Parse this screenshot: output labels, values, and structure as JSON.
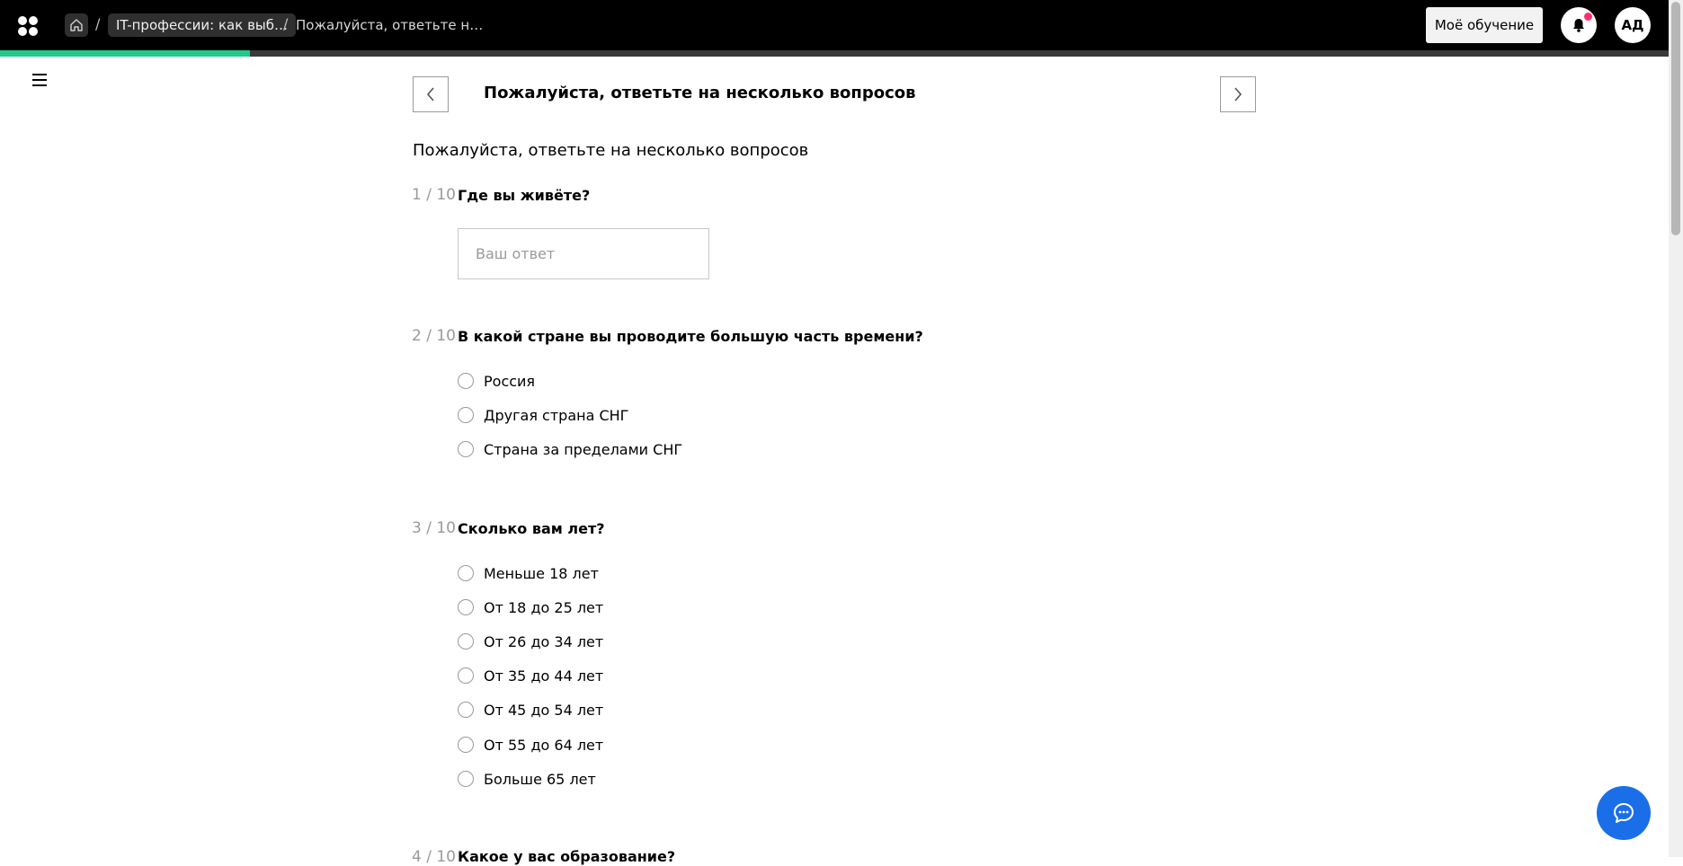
{
  "header": {
    "breadcrumb_course": "IT-профессии: как выб…",
    "breadcrumb_current": "Пожалуйста, ответьте н…",
    "breadcrumb_separator": "/",
    "my_learning_label": "Моё обучение",
    "avatar_initials": "АД",
    "course_progress_percent": 15,
    "colors": {
      "progress": "#23c98a",
      "notification_dot": "#ff2e6d"
    }
  },
  "main": {
    "title": "Пожалуйста, ответьте на несколько вопросов",
    "subtitle": "Пожалуйста, ответьте на несколько вопросов",
    "questions": [
      {
        "number": "1 / 10",
        "text": "Где вы живёте?",
        "input_placeholder": "Ваш ответ",
        "input_value": ""
      },
      {
        "number": "2 / 10",
        "text": "В какой стране вы проводите большую часть времени?",
        "options": [
          "Россия",
          "Другая страна СНГ",
          "Страна за пределами СНГ"
        ]
      },
      {
        "number": "3 / 10",
        "text": "Сколько вам лет?",
        "options": [
          "Меньше 18 лет",
          "От 18 до 25 лет",
          "От 26 до 34 лет",
          "От 35 до 44 лет",
          "От 45 до 54 лет",
          "От 55 до 64 лет",
          "Больше 65 лет"
        ]
      },
      {
        "number": "4 / 10",
        "text": "Какое у вас образование?"
      }
    ]
  },
  "icons": [
    "logo-icon",
    "home-icon",
    "bell-icon",
    "menu-icon",
    "chevron-left-icon",
    "chevron-right-icon",
    "chat-icon"
  ],
  "accent_chat_color": "#1a6fe8"
}
